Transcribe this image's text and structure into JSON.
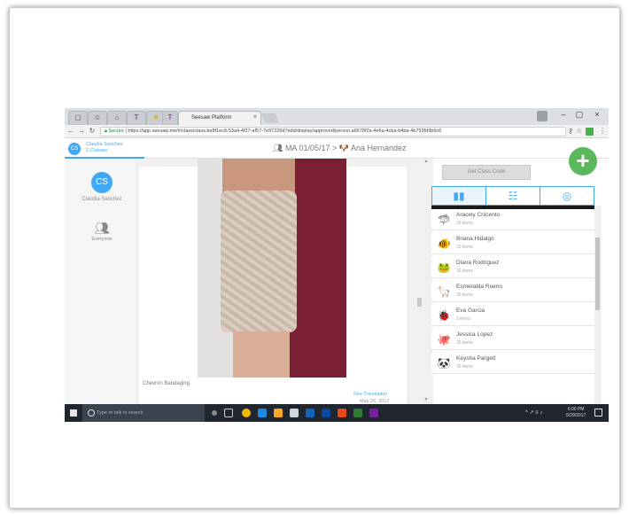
{
  "browser": {
    "tab_title": "Seesaw Platform",
    "tab_close": "×",
    "url_secure": "Secure",
    "url": "https://app.seesaw.me/#/class/class.be8f1ec8-53a4-4f27-af57-7e97226d7edd/display/approved/person.a6678f2a-4e6a-4cba-b4ba-4b793fd9b6c6",
    "min": "–",
    "max": "▢",
    "close": "×"
  },
  "header": {
    "teacher_initials": "CS",
    "teacher_name": "Claudia Sanchez",
    "classes": "2 Classes",
    "breadcrumb": "MA 01/05/17  >  🐶 Ana Hernandez",
    "add_button": "+"
  },
  "sidebar": {
    "initials": "CS",
    "name": "Claudia Sanchez",
    "everyone": "Everyone"
  },
  "post": {
    "caption": "Chevron Bandaging",
    "see_translation": "See Translation",
    "date": "May 26, 2017"
  },
  "right_panel": {
    "class_code_button": "Get Class Code",
    "tabs": [
      {
        "icon": "▮▮"
      },
      {
        "icon": "☷"
      },
      {
        "icon": "◎"
      }
    ],
    "students": [
      {
        "icon": "🦈",
        "name": "Aracely Criicento",
        "items": "35 items"
      },
      {
        "icon": "🐠",
        "name": "Briana Hidalgo",
        "items": "33 items"
      },
      {
        "icon": "🐸",
        "name": "Diana Rodriguez",
        "items": "35 items"
      },
      {
        "icon": "🦙",
        "name": "Esmeralda Rueno",
        "items": "35 items"
      },
      {
        "icon": "🐞",
        "name": "Eva Garcia",
        "items": "3 items"
      },
      {
        "icon": "🐙",
        "name": "Jessica Lopez",
        "items": "35 items"
      },
      {
        "icon": "🐼",
        "name": "Keysha Pargett",
        "items": "35 items"
      }
    ]
  },
  "taskbar": {
    "search_placeholder": "Type or talk to search",
    "tray": "^ ↗ ≡ ♪",
    "time": "6:00 PM",
    "date": "5/29/2017"
  },
  "colors": {
    "accent": "#3fa9f5",
    "add_green": "#5cb85c",
    "taskbar": "#1f2630"
  }
}
